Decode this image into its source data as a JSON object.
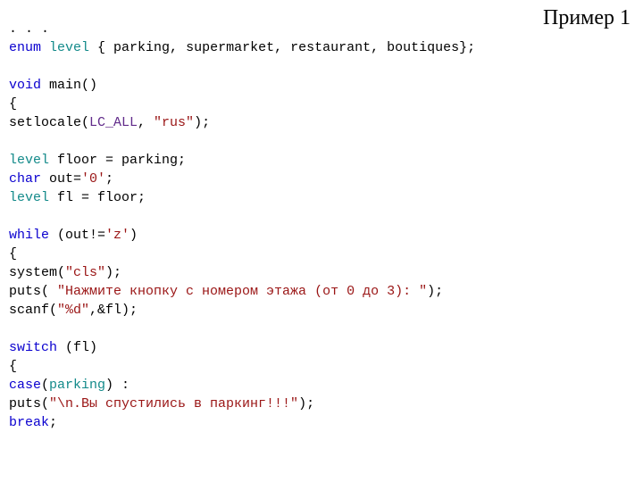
{
  "title": "Пример 1",
  "code": {
    "ell": ". . .",
    "l1": {
      "kw": "enum",
      "type": "level",
      "rest": " { parking, supermarket, restaurant, boutiques};"
    },
    "l3": {
      "kw": "void",
      "rest": " main()"
    },
    "l4": "{",
    "l5": {
      "fn": "setlocale(",
      "macro": "LC_ALL",
      "mid": ", ",
      "str": "\"rus\"",
      "end": ");"
    },
    "l7": {
      "type": "level",
      "rest": " floor = parking;"
    },
    "l8": {
      "kw": "char",
      "mid": " out=",
      "str": "'0'",
      "end": ";"
    },
    "l9": {
      "type": "level",
      "rest": " fl = floor;"
    },
    "l11": {
      "kw": "while",
      "mid": " (out!=",
      "str": "'z'",
      "end": ")"
    },
    "l12": "{",
    "l13": {
      "fn": "system(",
      "str": "\"cls\"",
      "end": ");"
    },
    "l14": {
      "fn": "puts( ",
      "str": "\"Нажмите кнопку с номером этажа (от 0 до 3): \"",
      "end": ");"
    },
    "l15": {
      "fn": "scanf(",
      "str": "\"%d\"",
      "end": ",&fl);"
    },
    "l17": {
      "kw": "switch",
      "rest": " (fl)"
    },
    "l18": "{",
    "l19": {
      "kw": "case",
      "p1": "(",
      "type": "parking",
      "p2": ") :"
    },
    "l20": {
      "fn": "puts(",
      "str": "\"\\n.Вы спустились в паркинг!!!\"",
      "end": ");"
    },
    "l21": {
      "kw": "break",
      "end": ";"
    }
  }
}
